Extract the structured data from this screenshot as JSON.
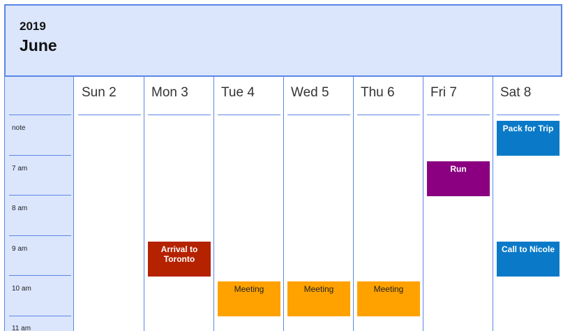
{
  "header": {
    "year": "2019",
    "month": "June"
  },
  "time_slots": [
    "note",
    "7 am",
    "8 am",
    "9 am",
    "10 am",
    "11 am"
  ],
  "days": [
    "Sun 2",
    "Mon 3",
    "Tue 4",
    "Wed 5",
    "Thu 6",
    "Fri 7",
    "Sat 8"
  ],
  "events": [
    {
      "title": "Pack for Trip",
      "day": "Sat 8",
      "slot": "note",
      "color": "#0a7ac8"
    },
    {
      "title": "Run",
      "day": "Fri 7",
      "slot": "7 am",
      "color": "#8b0080"
    },
    {
      "title": "Arrival to Toronto",
      "day": "Mon 3",
      "slot": "9 am",
      "color": "#b52200"
    },
    {
      "title": "Call to Nicole",
      "day": "Sat 8",
      "slot": "9 am",
      "color": "#0a7ac8"
    },
    {
      "title": "Meeting",
      "day": "Tue 4",
      "slot": "10 am",
      "color": "#ffa200"
    },
    {
      "title": "Meeting",
      "day": "Wed 5",
      "slot": "10 am",
      "color": "#ffa200"
    },
    {
      "title": "Meeting",
      "day": "Thu 6",
      "slot": "10 am",
      "color": "#ffa200"
    }
  ],
  "colors": {
    "accent": "#5b86e5",
    "header_bg": "#dbe6fd"
  }
}
